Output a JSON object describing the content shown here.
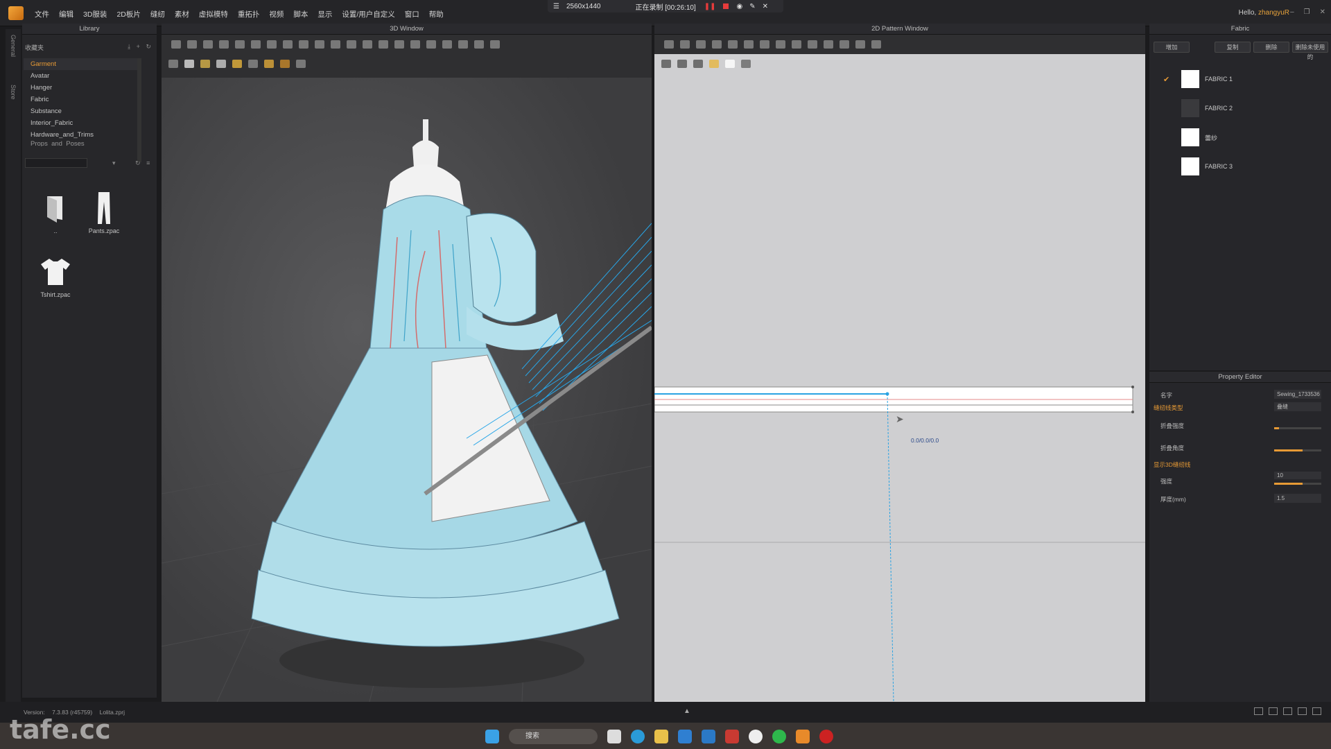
{
  "app": {
    "menu": [
      "文件",
      "编辑",
      "3D服装",
      "2D板片",
      "缝纫",
      "素材",
      "虚拟模特",
      "重拓扑",
      "视频",
      "脚本",
      "显示",
      "设置/用户自定义",
      "窗口",
      "帮助"
    ]
  },
  "recorder": {
    "resolution": "2560x1440",
    "status": "正在录制 [00:26:10]"
  },
  "user": {
    "greeting": "Hello,",
    "name": "zhangyuR"
  },
  "sidestrip": {
    "tabs": [
      "General",
      "Store"
    ]
  },
  "library": {
    "title": "Library",
    "favorites_label": "收藏夹",
    "tree": [
      "Garment",
      "Avatar",
      "Hanger",
      "Fabric",
      "Substance",
      "Interior_Fabric",
      "Hardware_and_Trims",
      "Props_and_Poses"
    ],
    "selected": "Garment",
    "thumbs": [
      {
        "label": "..",
        "icon": "folder-icon"
      },
      {
        "label": "Pants.zpac",
        "icon": "pants-icon"
      },
      {
        "label": "Tshirt.zpac",
        "icon": "tshirt-icon"
      }
    ]
  },
  "window3d": {
    "title": "3D Window"
  },
  "window2d": {
    "title": "2D Pattern Window",
    "measure": "0.0/0.0/0.0"
  },
  "fabric": {
    "title": "Fabric",
    "buttons": [
      "增加",
      "复制",
      "删除",
      "删除未使用的"
    ],
    "items": [
      {
        "name": "FABRIC 1",
        "color": "#ffffff",
        "checked": true
      },
      {
        "name": "FABRIC 2",
        "color": "#3a3a3d",
        "checked": false
      },
      {
        "name": "蕾纱",
        "color": "#ffffff",
        "checked": false
      },
      {
        "name": "FABRIC 3",
        "color": "#ffffff",
        "checked": false
      }
    ]
  },
  "property": {
    "title": "Property Editor",
    "name_label": "名字",
    "name_value": "Sewing_1733536",
    "section1": "缝纫线类型",
    "type_value": "叠缝",
    "fold_strength": "折叠强度",
    "fold_angle": "折叠角度",
    "section2": "显示3D缝纫线",
    "width_label": "强度",
    "width_value": "10",
    "thickness_label": "厚度(mm)",
    "thickness_value": "1.5",
    "fold_strength_level": 0.1,
    "fold_angle_level": 0.6,
    "width_level": 0.6
  },
  "status": {
    "version_label": "Version:",
    "version": "7.3.83 (r45759)",
    "file": "Lolita.zprj"
  },
  "taskbar": {
    "search": "搜索"
  },
  "watermark": "tafe.cc"
}
